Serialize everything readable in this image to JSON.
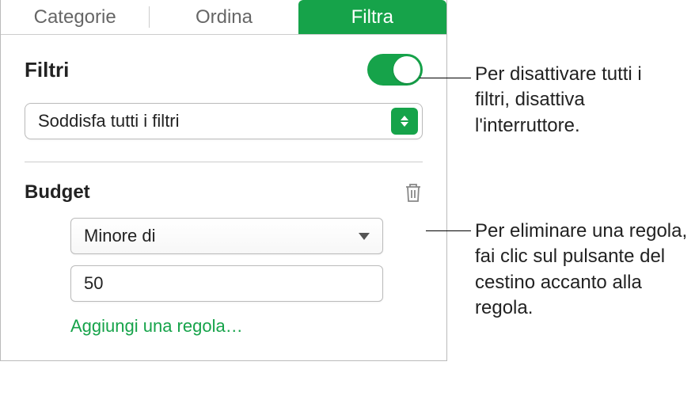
{
  "tabs": {
    "categories": "Categorie",
    "sort": "Ordina",
    "filter": "Filtra"
  },
  "filters": {
    "title": "Filtri",
    "match_mode": "Soddisfa tutti i filtri"
  },
  "rule": {
    "column": "Budget",
    "operator": "Minore di",
    "value": "50",
    "add_rule": "Aggiungi una regola…"
  },
  "callouts": {
    "toggle": "Per disattivare tutti i filtri, disattiva l'interruttore.",
    "trash": "Per eliminare una regola, fai clic sul pulsante del cestino accanto alla regola."
  }
}
